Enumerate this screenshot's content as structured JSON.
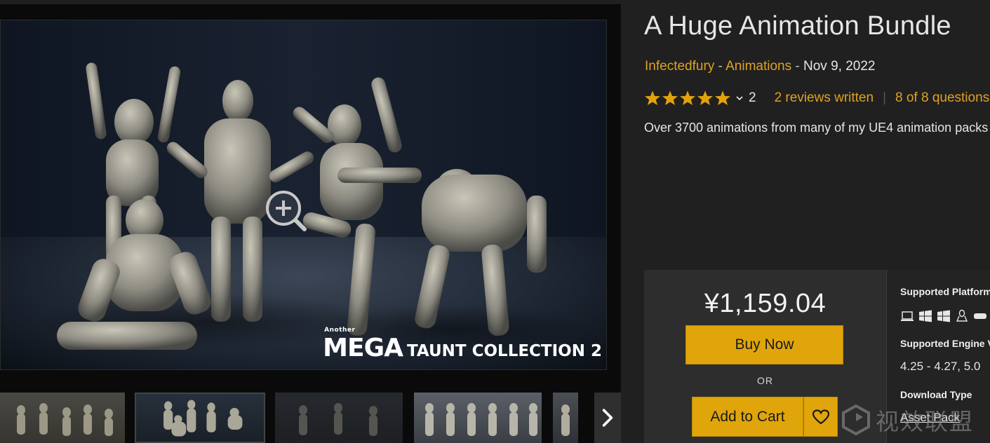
{
  "product": {
    "title": "A Huge Animation Bundle",
    "seller": "Infectedfury",
    "separator1": " - ",
    "category": "Animations",
    "separator2": " - ",
    "date": "Nov 9, 2022",
    "rating_stars": 5,
    "rating_count": "2",
    "reviews_link": "2 reviews written",
    "questions_link": "8 of 8 questions",
    "description": "Over 3700 animations from many of my UE4 animation packs"
  },
  "gallery": {
    "caption_small": "Another",
    "caption_big": "MEGA",
    "caption_rest": "TAUNT COLLECTION 2",
    "zoom_icon": "zoom-in-icon",
    "next_icon": "chevron-right-icon",
    "thumbnail_count": 5,
    "selected_thumbnail": 2
  },
  "purchase": {
    "price": "¥1,159.04",
    "buy_now": "Buy Now",
    "or": "OR",
    "add_to_cart": "Add to Cart",
    "wishlist_icon": "heart-icon"
  },
  "specs": {
    "platforms_label": "Supported Platforms",
    "platform_icons": [
      "laptop-icon",
      "windows-icon",
      "windows-icon",
      "linux-icon",
      "vr-icon"
    ],
    "engine_label": "Supported Engine Versions",
    "engine_value": "4.25 - 4.27, 5.0",
    "download_label": "Download Type",
    "download_value": "Asset Pack"
  },
  "watermark": {
    "text": "视效联盟"
  },
  "colors": {
    "accent": "#dfa223",
    "button": "#e0a50a",
    "background": "#202020",
    "panel": "#2d2d2d"
  }
}
